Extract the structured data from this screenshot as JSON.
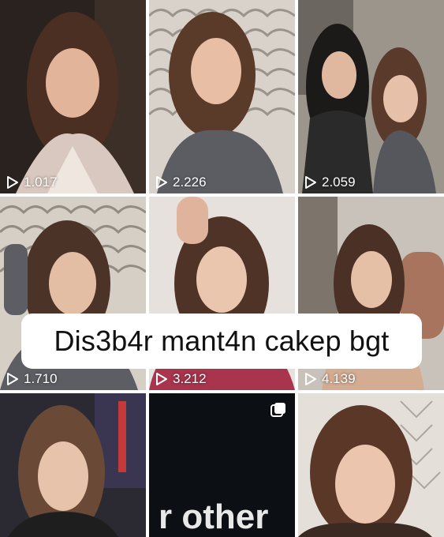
{
  "grid": {
    "tiles": [
      {
        "views": "1.017"
      },
      {
        "views": "2.226"
      },
      {
        "views": "2.059"
      },
      {
        "views": "1.710"
      },
      {
        "views": "3.212"
      },
      {
        "views": "4.139"
      },
      {
        "views": ""
      },
      {
        "views": "",
        "overlay_text": "r other"
      },
      {
        "views": ""
      }
    ]
  },
  "caption": {
    "text": "Dis3b4r mant4n cakep bgt"
  },
  "icons": {
    "play": "play-icon",
    "multi": "multiple-posts-icon"
  }
}
